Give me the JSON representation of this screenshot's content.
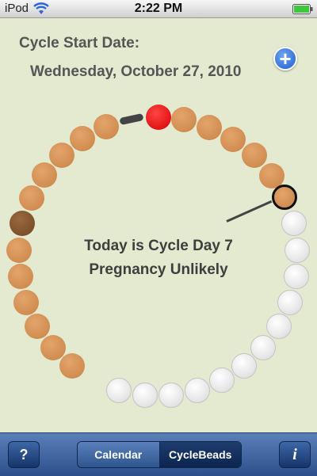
{
  "status_bar": {
    "carrier": "iPod",
    "time": "2:22 PM"
  },
  "header": {
    "label": "Cycle Start Date:",
    "date": "Wednesday, October 27, 2010",
    "add_button_label": "+"
  },
  "cycle": {
    "today_text": "Today is Cycle Day 7",
    "status_text": "Pregnancy Unlikely",
    "current_day": 7,
    "bead_colors": {
      "red": "#e00000",
      "brown": "#d08c52",
      "dark": "#7a4b28",
      "white": "#f0f0f0"
    }
  },
  "toolbar": {
    "help_label": "?",
    "info_label": "i",
    "tabs": [
      {
        "label": "Calendar",
        "selected": false
      },
      {
        "label": "CycleBeads",
        "selected": true
      }
    ]
  }
}
